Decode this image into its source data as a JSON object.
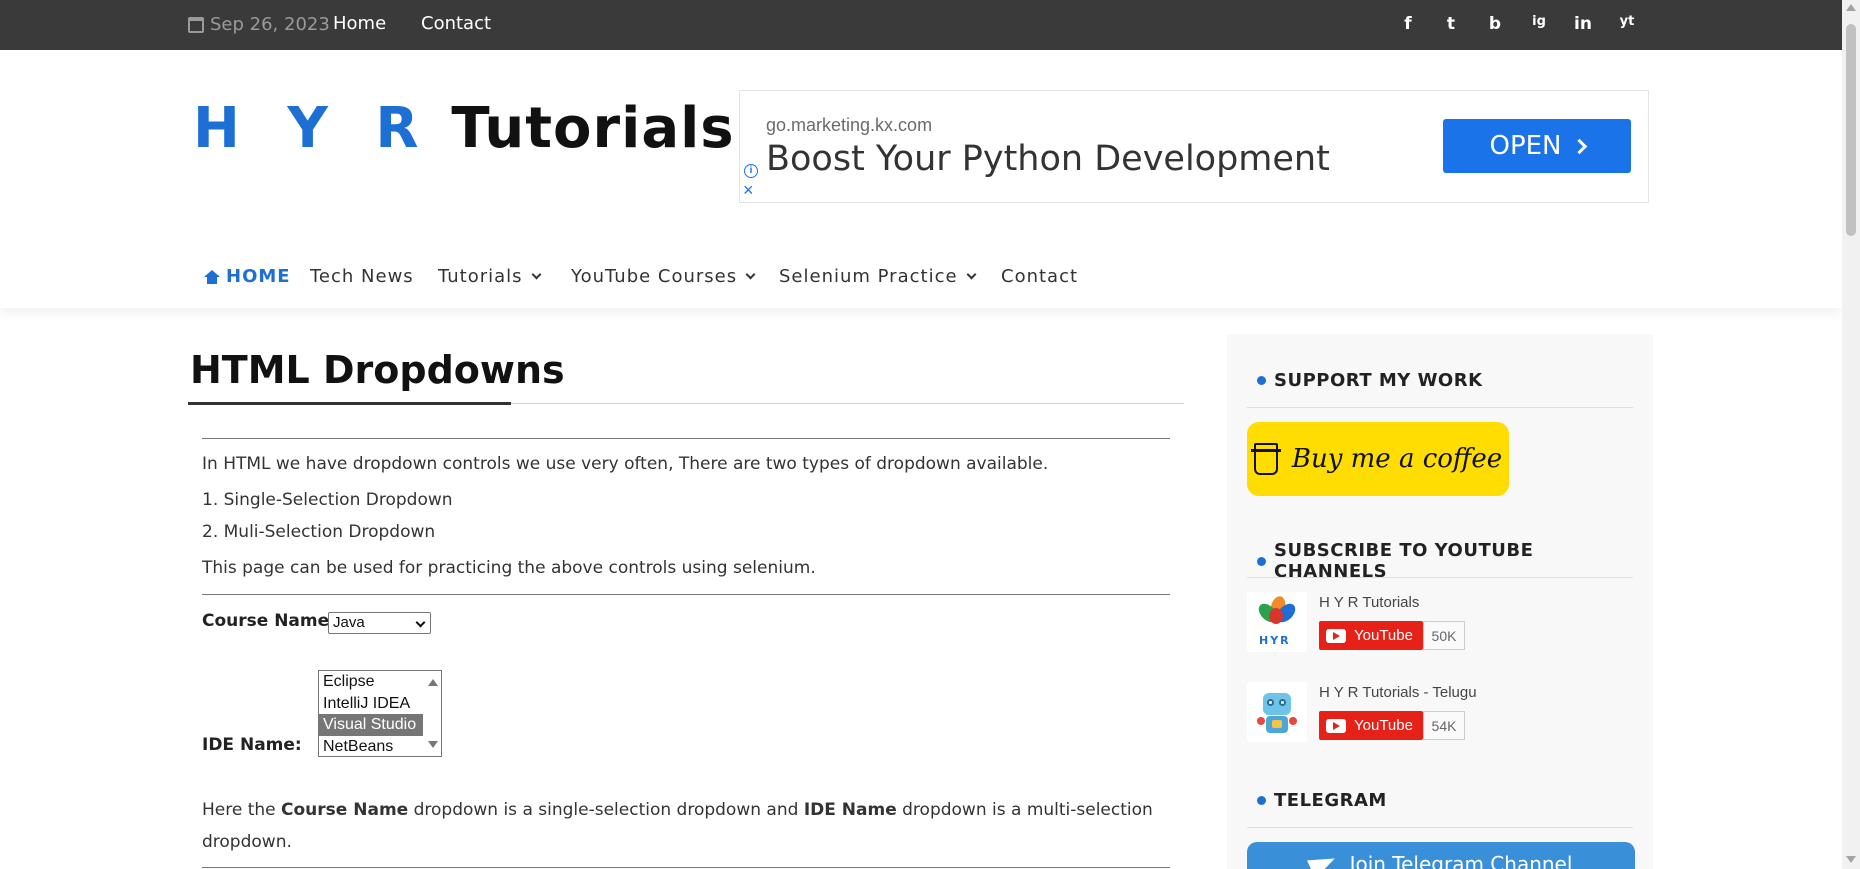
{
  "topbar": {
    "date": "Sep 26, 2023",
    "links": [
      "Home",
      "Contact"
    ],
    "social_icons": [
      "facebook-icon",
      "twitter-icon",
      "blogger-icon",
      "instagram-icon",
      "linkedin-icon",
      "youtube-icon"
    ],
    "social_glyphs": [
      "f",
      "t",
      "b",
      "ig",
      "in",
      "yt"
    ]
  },
  "header": {
    "logo_hyr": "H Y R",
    "logo_tutorials": "Tutorials"
  },
  "ad": {
    "domain": "go.marketing.kx.com",
    "headline": "Boost Your Python Development",
    "button": "OPEN"
  },
  "nav": {
    "items": [
      "HOME",
      "Tech News",
      "Tutorials",
      "YouTube Courses",
      "Selenium Practice",
      "Contact"
    ]
  },
  "page": {
    "title": "HTML Dropdowns",
    "intro": "In HTML we have dropdown controls we use very often, There are two types of dropdown available.",
    "item1": "1. Single-Selection Dropdown",
    "item2": "2. Muli-Selection Dropdown",
    "practice": "This page can be used for practicing the above controls using selenium.",
    "course_label": "Course Name:",
    "course_selected": "Java",
    "ide_label": "IDE Name:",
    "ide_options": [
      "Eclipse",
      "IntelliJ IDEA",
      "Visual Studio",
      "NetBeans"
    ],
    "ide_selected": "Visual Studio",
    "explain_1": "Here the ",
    "explain_course": "Course Name",
    "explain_2": " dropdown is a single-selection dropdown and ",
    "explain_ide": "IDE Name",
    "explain_3": " dropdown is a multi-selection",
    "explain_4": "dropdown."
  },
  "sidebar": {
    "support_title": "SUPPORT MY WORK",
    "bmc_label": "Buy me a coffee",
    "subscribe_title": "SUBSCRIBE TO YOUTUBE CHANNELS",
    "channels": [
      {
        "name": "H Y R Tutorials",
        "button": "YouTube",
        "count": "50K"
      },
      {
        "name": "H Y R Tutorials - Telugu",
        "button": "YouTube",
        "count": "54K"
      }
    ],
    "hyr_logo_text": "HYR",
    "telegram_title": "TELEGRAM",
    "telegram_button": "Join Telegram Channel"
  },
  "colors": {
    "accent": "#1e6fd4",
    "topbar": "#3a3a3a",
    "bmc_yellow": "#ffdd00",
    "youtube_red": "#e62117",
    "telegram_blue": "#3a8fd9"
  }
}
